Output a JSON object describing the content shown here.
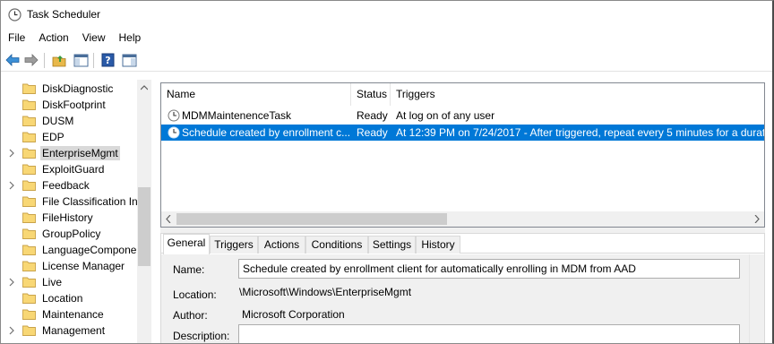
{
  "window": {
    "title": "Task Scheduler"
  },
  "menu": [
    "File",
    "Action",
    "View",
    "Help"
  ],
  "toolbar": {
    "buttons": [
      "back-arrow-icon",
      "forward-arrow-icon",
      "up-folder-icon",
      "show-hide-console-tree-icon",
      "help-icon",
      "show-hide-action-pane-icon"
    ]
  },
  "tree": {
    "items": [
      {
        "label": "DiskDiagnostic",
        "expandable": false,
        "selected": false
      },
      {
        "label": "DiskFootprint",
        "expandable": false,
        "selected": false
      },
      {
        "label": "DUSM",
        "expandable": false,
        "selected": false
      },
      {
        "label": "EDP",
        "expandable": false,
        "selected": false
      },
      {
        "label": "EnterpriseMgmt",
        "expandable": true,
        "selected": true
      },
      {
        "label": "ExploitGuard",
        "expandable": false,
        "selected": false
      },
      {
        "label": "Feedback",
        "expandable": true,
        "selected": false
      },
      {
        "label": "File Classification In",
        "expandable": false,
        "selected": false
      },
      {
        "label": "FileHistory",
        "expandable": false,
        "selected": false
      },
      {
        "label": "GroupPolicy",
        "expandable": false,
        "selected": false
      },
      {
        "label": "LanguageCompone",
        "expandable": false,
        "selected": false
      },
      {
        "label": "License Manager",
        "expandable": false,
        "selected": false
      },
      {
        "label": "Live",
        "expandable": true,
        "selected": false
      },
      {
        "label": "Location",
        "expandable": false,
        "selected": false
      },
      {
        "label": "Maintenance",
        "expandable": false,
        "selected": false
      },
      {
        "label": "Management",
        "expandable": true,
        "selected": false
      }
    ]
  },
  "tasks": {
    "columns": [
      "Name",
      "Status",
      "Triggers"
    ],
    "rows": [
      {
        "name": "MDMMaintenenceTask",
        "status": "Ready",
        "trigger": "At log on of any user",
        "selected": false
      },
      {
        "name": "Schedule created by enrollment c...",
        "status": "Ready",
        "trigger": "At 12:39 PM on 7/24/2017 - After triggered, repeat every 5 minutes for a durati",
        "selected": true
      }
    ]
  },
  "details": {
    "tabs": [
      "General",
      "Triggers",
      "Actions",
      "Conditions",
      "Settings",
      "History"
    ],
    "active_tab": "General",
    "fields": {
      "name_label": "Name:",
      "name_value": "Schedule created by enrollment client for automatically enrolling in MDM from AAD",
      "location_label": "Location:",
      "location_value": "\\Microsoft\\Windows\\EnterpriseMgmt",
      "author_label": "Author:",
      "author_value": "Microsoft Corporation",
      "description_label": "Description:",
      "description_value": ""
    }
  },
  "colors": {
    "selection_blue": "#0078d7",
    "folder_yellow": "#f8d775",
    "tree_selection": "#d9d9d9"
  }
}
